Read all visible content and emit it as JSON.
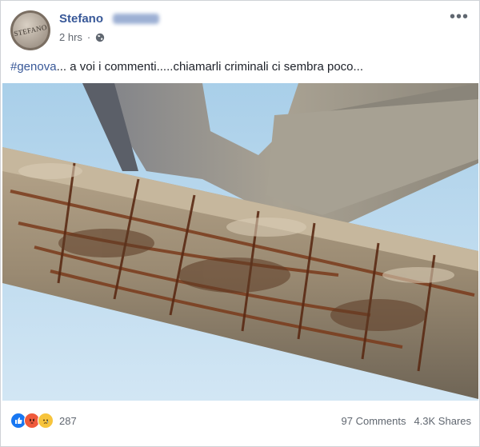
{
  "post": {
    "author": "Stefano",
    "avatar_text": "STEFANO",
    "time": "2 hrs",
    "privacy_icon": "globe-icon",
    "menu_icon": "more-icon",
    "hashtag": "#genova",
    "text_rest": "... a voi i commenti.....chiamarli criminali ci sembra poco..."
  },
  "footer": {
    "reaction_icons": [
      "like-icon",
      "angry-icon",
      "sad-icon"
    ],
    "reaction_count": "287",
    "comments": "97 Comments",
    "shares": "4.3K Shares"
  },
  "colors": {
    "link": "#385898",
    "text": "#1d2129",
    "muted": "#606770",
    "sky": "#9fc7e6"
  }
}
